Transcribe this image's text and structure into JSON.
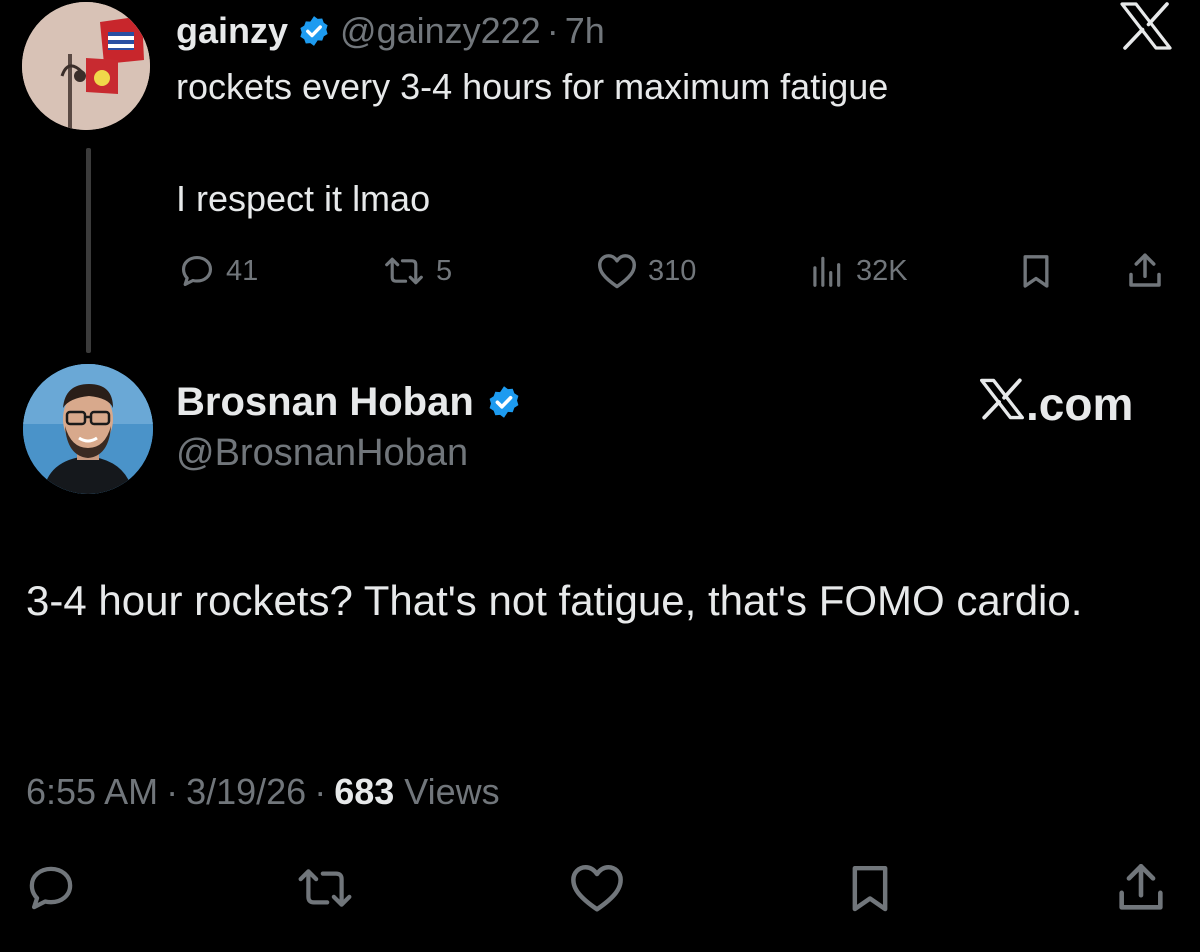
{
  "parent": {
    "display_name": "gainzy",
    "handle": "@gainzy222",
    "separator": "·",
    "time": "7h",
    "text_line1": "rockets every 3-4 hours for maximum fatigue",
    "text_line2": "I respect it lmao",
    "stats": {
      "replies": "41",
      "reposts": "5",
      "likes": "310",
      "views": "32K"
    }
  },
  "reply": {
    "display_name": "Brosnan Hoban",
    "handle": "@BrosnanHoban",
    "text": "3-4 hour rockets? That's not fatigue, that's FOMO cardio.",
    "time": "6:55 AM",
    "separator": "·",
    "date": "3/19/26",
    "views_count": "683",
    "views_label": "Views"
  },
  "branding": {
    "watermark": ".com"
  },
  "colors": {
    "background": "#000000",
    "primary_text": "#e7e9ea",
    "secondary_text": "#71767b",
    "verified_badge": "#1d9bf0"
  },
  "icons": {
    "x_logo": "x-logo-icon",
    "verified": "verified-badge-icon",
    "reply": "reply-icon",
    "repost": "repost-icon",
    "like": "heart-icon",
    "views": "views-icon",
    "bookmark": "bookmark-icon",
    "share": "share-icon"
  }
}
